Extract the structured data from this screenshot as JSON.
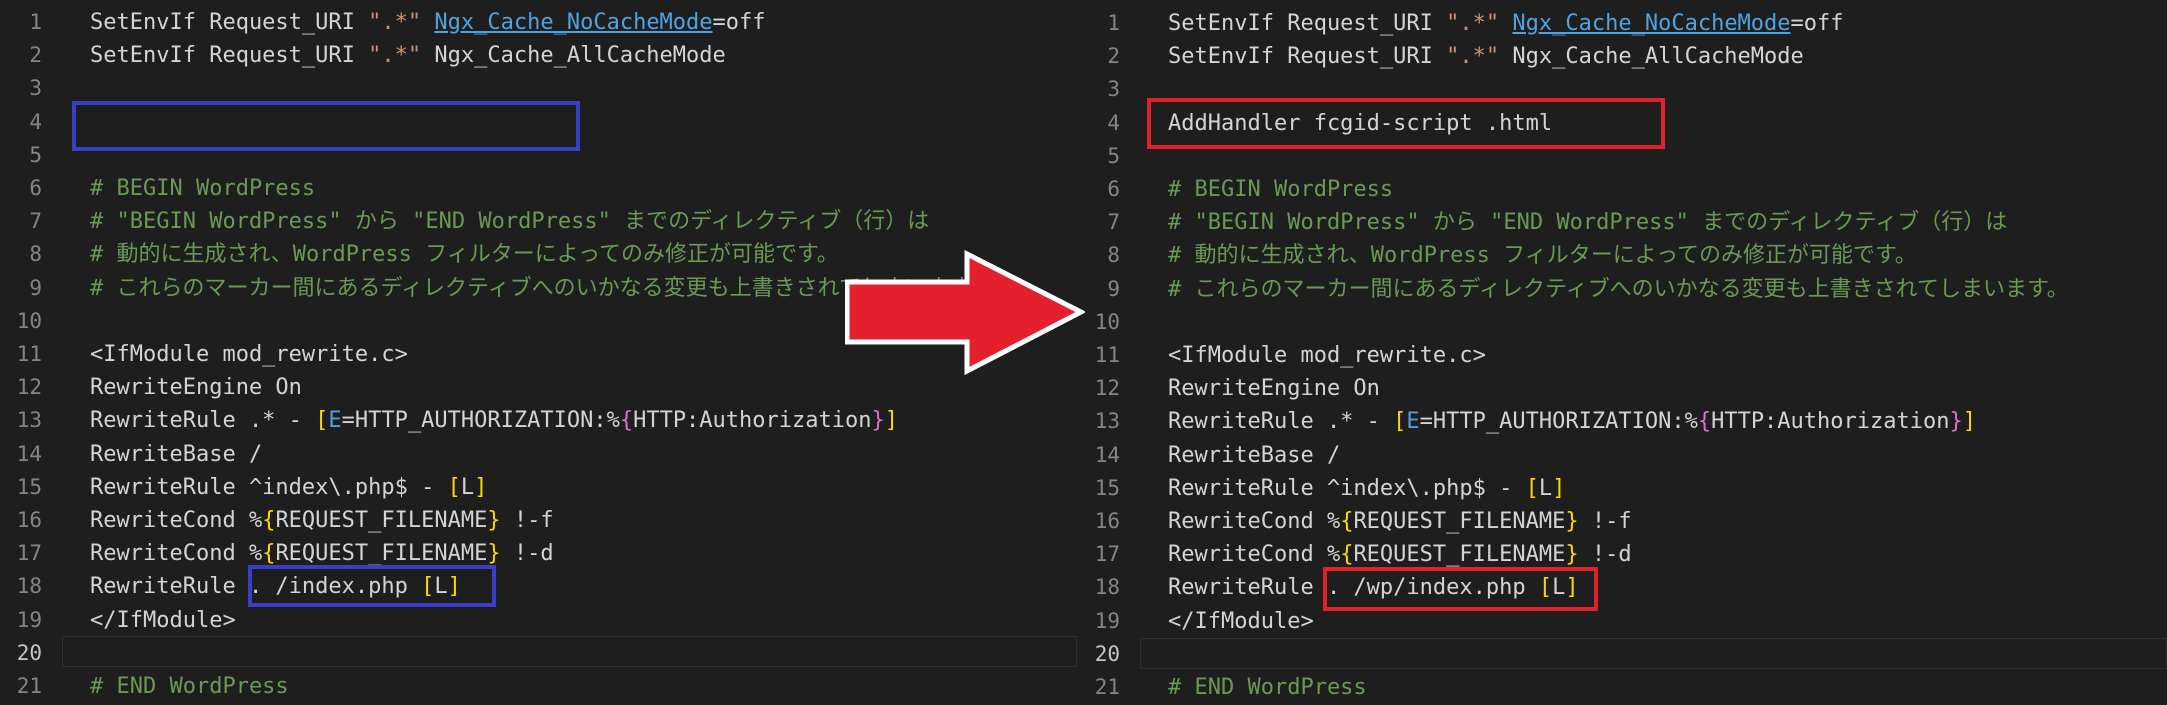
{
  "colors": {
    "blue_box": "#3a3ec8",
    "red_box": "#e0202a",
    "arrow": "#e3202c"
  },
  "left": {
    "lines": [
      {
        "n": "1",
        "segs": [
          {
            "t": "SetEnvIf Request_URI ",
            "c": ""
          },
          {
            "t": "\".*\"",
            "c": "str"
          },
          {
            "t": " ",
            "c": ""
          },
          {
            "t": "Ngx_Cache_NoCacheMode",
            "c": "var"
          },
          {
            "t": "=off",
            "c": ""
          }
        ]
      },
      {
        "n": "2",
        "segs": [
          {
            "t": "SetEnvIf Request_URI ",
            "c": ""
          },
          {
            "t": "\".*\"",
            "c": "str"
          },
          {
            "t": " Ngx_Cache_AllCacheMode",
            "c": ""
          }
        ]
      },
      {
        "n": "3",
        "segs": []
      },
      {
        "n": "4",
        "segs": []
      },
      {
        "n": "5",
        "segs": []
      },
      {
        "n": "6",
        "segs": [
          {
            "t": "# BEGIN WordPress",
            "c": "cm"
          }
        ]
      },
      {
        "n": "7",
        "segs": [
          {
            "t": "# \"BEGIN WordPress\" から \"END WordPress\" までのディレクティブ（行）は",
            "c": "cm"
          }
        ]
      },
      {
        "n": "8",
        "segs": [
          {
            "t": "# 動的に生成され、WordPress フィルターによってのみ修正が可能です。",
            "c": "cm"
          }
        ]
      },
      {
        "n": "9",
        "segs": [
          {
            "t": "# これらのマーカー間にあるディレクティブへのいかなる変更も上書きされてしまいます。",
            "c": "cm"
          }
        ]
      },
      {
        "n": "10",
        "segs": []
      },
      {
        "n": "11",
        "segs": [
          {
            "t": "<IfModule mod_rewrite.c>",
            "c": ""
          }
        ]
      },
      {
        "n": "12",
        "segs": [
          {
            "t": "RewriteEngine On",
            "c": ""
          }
        ]
      },
      {
        "n": "13",
        "segs": [
          {
            "t": "RewriteRule .* - ",
            "c": ""
          },
          {
            "t": "[",
            "c": "br1"
          },
          {
            "t": "E",
            "c": "key"
          },
          {
            "t": "=HTTP_AUTHORIZATION:%",
            "c": ""
          },
          {
            "t": "{",
            "c": "br2"
          },
          {
            "t": "HTTP:Authorization",
            "c": ""
          },
          {
            "t": "}",
            "c": "br2"
          },
          {
            "t": "]",
            "c": "br1"
          }
        ]
      },
      {
        "n": "14",
        "segs": [
          {
            "t": "RewriteBase /",
            "c": ""
          }
        ]
      },
      {
        "n": "15",
        "segs": [
          {
            "t": "RewriteRule ^index\\.php$ - ",
            "c": ""
          },
          {
            "t": "[",
            "c": "br1"
          },
          {
            "t": "L",
            "c": ""
          },
          {
            "t": "]",
            "c": "br1"
          }
        ]
      },
      {
        "n": "16",
        "segs": [
          {
            "t": "RewriteCond %",
            "c": ""
          },
          {
            "t": "{",
            "c": "br1"
          },
          {
            "t": "REQUEST_FILENAME",
            "c": ""
          },
          {
            "t": "}",
            "c": "br1"
          },
          {
            "t": " !-f",
            "c": ""
          }
        ]
      },
      {
        "n": "17",
        "segs": [
          {
            "t": "RewriteCond %",
            "c": ""
          },
          {
            "t": "{",
            "c": "br1"
          },
          {
            "t": "REQUEST_FILENAME",
            "c": ""
          },
          {
            "t": "}",
            "c": "br1"
          },
          {
            "t": " !-d",
            "c": ""
          }
        ]
      },
      {
        "n": "18",
        "segs": [
          {
            "t": "RewriteRule . /index.php ",
            "c": ""
          },
          {
            "t": "[",
            "c": "br1"
          },
          {
            "t": "L",
            "c": ""
          },
          {
            "t": "]",
            "c": "br1"
          }
        ]
      },
      {
        "n": "19",
        "segs": [
          {
            "t": "</IfModule>",
            "c": ""
          }
        ]
      },
      {
        "n": "20",
        "segs": []
      },
      {
        "n": "21",
        "segs": [
          {
            "t": "# END WordPress",
            "c": "cm"
          }
        ]
      }
    ]
  },
  "right": {
    "lines": [
      {
        "n": "1",
        "segs": [
          {
            "t": "SetEnvIf Request_URI ",
            "c": ""
          },
          {
            "t": "\".*\"",
            "c": "str"
          },
          {
            "t": " ",
            "c": ""
          },
          {
            "t": "Ngx_Cache_NoCacheMode",
            "c": "var"
          },
          {
            "t": "=off",
            "c": ""
          }
        ]
      },
      {
        "n": "2",
        "segs": [
          {
            "t": "SetEnvIf Request_URI ",
            "c": ""
          },
          {
            "t": "\".*\"",
            "c": "str"
          },
          {
            "t": " Ngx_Cache_AllCacheMode",
            "c": ""
          }
        ]
      },
      {
        "n": "3",
        "segs": []
      },
      {
        "n": "4",
        "segs": [
          {
            "t": "AddHandler fcgid-script .html",
            "c": ""
          }
        ]
      },
      {
        "n": "5",
        "segs": []
      },
      {
        "n": "6",
        "segs": [
          {
            "t": "# BEGIN WordPress",
            "c": "cm"
          }
        ]
      },
      {
        "n": "7",
        "segs": [
          {
            "t": "# \"BEGIN WordPress\" から \"END WordPress\" までのディレクティブ（行）は",
            "c": "cm"
          }
        ]
      },
      {
        "n": "8",
        "segs": [
          {
            "t": "# 動的に生成され、WordPress フィルターによってのみ修正が可能です。",
            "c": "cm"
          }
        ]
      },
      {
        "n": "9",
        "segs": [
          {
            "t": "# これらのマーカー間にあるディレクティブへのいかなる変更も上書きされてしまいます。",
            "c": "cm"
          }
        ]
      },
      {
        "n": "10",
        "segs": []
      },
      {
        "n": "11",
        "segs": [
          {
            "t": "<IfModule mod_rewrite.c>",
            "c": ""
          }
        ]
      },
      {
        "n": "12",
        "segs": [
          {
            "t": "RewriteEngine On",
            "c": ""
          }
        ]
      },
      {
        "n": "13",
        "segs": [
          {
            "t": "RewriteRule .* - ",
            "c": ""
          },
          {
            "t": "[",
            "c": "br1"
          },
          {
            "t": "E",
            "c": "key"
          },
          {
            "t": "=HTTP_AUTHORIZATION:%",
            "c": ""
          },
          {
            "t": "{",
            "c": "br2"
          },
          {
            "t": "HTTP:Authorization",
            "c": ""
          },
          {
            "t": "}",
            "c": "br2"
          },
          {
            "t": "]",
            "c": "br1"
          }
        ]
      },
      {
        "n": "14",
        "segs": [
          {
            "t": "RewriteBase /",
            "c": ""
          }
        ]
      },
      {
        "n": "15",
        "segs": [
          {
            "t": "RewriteRule ^index\\.php$ - ",
            "c": ""
          },
          {
            "t": "[",
            "c": "br1"
          },
          {
            "t": "L",
            "c": ""
          },
          {
            "t": "]",
            "c": "br1"
          }
        ]
      },
      {
        "n": "16",
        "segs": [
          {
            "t": "RewriteCond %",
            "c": ""
          },
          {
            "t": "{",
            "c": "br1"
          },
          {
            "t": "REQUEST_FILENAME",
            "c": ""
          },
          {
            "t": "}",
            "c": "br1"
          },
          {
            "t": " !-f",
            "c": ""
          }
        ]
      },
      {
        "n": "17",
        "segs": [
          {
            "t": "RewriteCond %",
            "c": ""
          },
          {
            "t": "{",
            "c": "br1"
          },
          {
            "t": "REQUEST_FILENAME",
            "c": ""
          },
          {
            "t": "}",
            "c": "br1"
          },
          {
            "t": " !-d",
            "c": ""
          }
        ]
      },
      {
        "n": "18",
        "segs": [
          {
            "t": "RewriteRule . /wp/index.php ",
            "c": ""
          },
          {
            "t": "[",
            "c": "br1"
          },
          {
            "t": "L",
            "c": ""
          },
          {
            "t": "]",
            "c": "br1"
          }
        ]
      },
      {
        "n": "19",
        "segs": [
          {
            "t": "</IfModule>",
            "c": ""
          }
        ]
      },
      {
        "n": "20",
        "segs": []
      },
      {
        "n": "21",
        "segs": [
          {
            "t": "# END WordPress",
            "c": "cm"
          }
        ]
      }
    ]
  }
}
